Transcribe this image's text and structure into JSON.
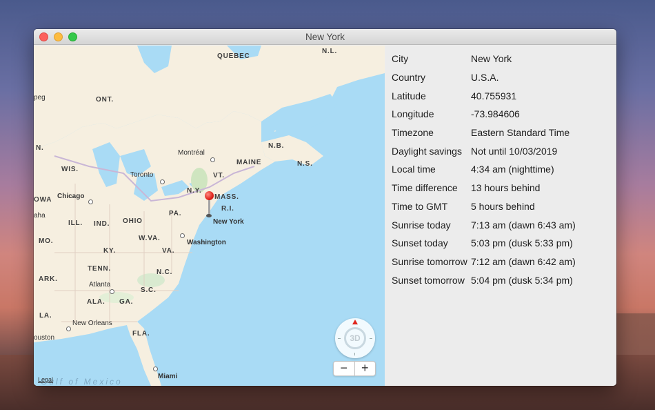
{
  "window": {
    "title": "New York"
  },
  "map": {
    "labels": {
      "quebec": "QUEBEC",
      "nl": "N.L.",
      "ont": "ONT.",
      "peg": "peg",
      "n": "N.",
      "nb": "N.B.",
      "ns": "N.S.",
      "montreal": "Montréal",
      "vt": "VT.",
      "maine": "MAINE",
      "wis": "WIS.",
      "toronto": "Toronto",
      "ny": "N.Y.",
      "mass": "MASS.",
      "ri": "R.I.",
      "newyork": "New York",
      "iowa": "OWA",
      "chicago": "Chicago",
      "pa": "PA.",
      "oha": "aha",
      "ill": "ILL.",
      "ind": "IND.",
      "ohio": "OHIO",
      "mo": "MO.",
      "wva": "W.VA.",
      "washington": "Washington",
      "ky": "KY.",
      "va": "VA.",
      "tenn": "TENN.",
      "nc": "N.C.",
      "ark": "ARK.",
      "atlanta": "Atlanta",
      "sc": "S.C.",
      "ala": "ALA.",
      "ga": "GA.",
      "la": "LA.",
      "neworleans": "New Orleans",
      "houston": "ouston",
      "fla": "FLA.",
      "miami": "Miami",
      "gulf": "Gulf of Mexico",
      "legal": "Legal"
    },
    "compass_label": "3D",
    "zoom_out": "−",
    "zoom_in": "+"
  },
  "info": {
    "rows": [
      {
        "key": "City",
        "value": "New York"
      },
      {
        "key": "Country",
        "value": "U.S.A."
      },
      {
        "key": "Latitude",
        "value": "40.755931"
      },
      {
        "key": "Longitude",
        "value": "-73.984606"
      },
      {
        "key": "Timezone",
        "value": "Eastern Standard Time"
      },
      {
        "key": "Daylight savings",
        "value": "Not until 10/03/2019"
      },
      {
        "key": "Local time",
        "value": "4:34 am (nighttime)"
      },
      {
        "key": "Time difference",
        "value": "13 hours behind"
      },
      {
        "key": "Time to GMT",
        "value": "5 hours  behind"
      },
      {
        "key": "Sunrise today",
        "value": "7:13 am (dawn 6:43 am)"
      },
      {
        "key": "Sunset today",
        "value": "5:03 pm (dusk 5:33 pm)"
      },
      {
        "key": "Sunrise tomorrow",
        "value": "7:12 am (dawn 6:42 am)"
      },
      {
        "key": "Sunset tomorrow",
        "value": "5:04 pm (dusk 5:34 pm)"
      }
    ]
  },
  "colors": {
    "water": "#a9dbf5",
    "land": "#f6efe0",
    "pin": "#e0241b"
  }
}
